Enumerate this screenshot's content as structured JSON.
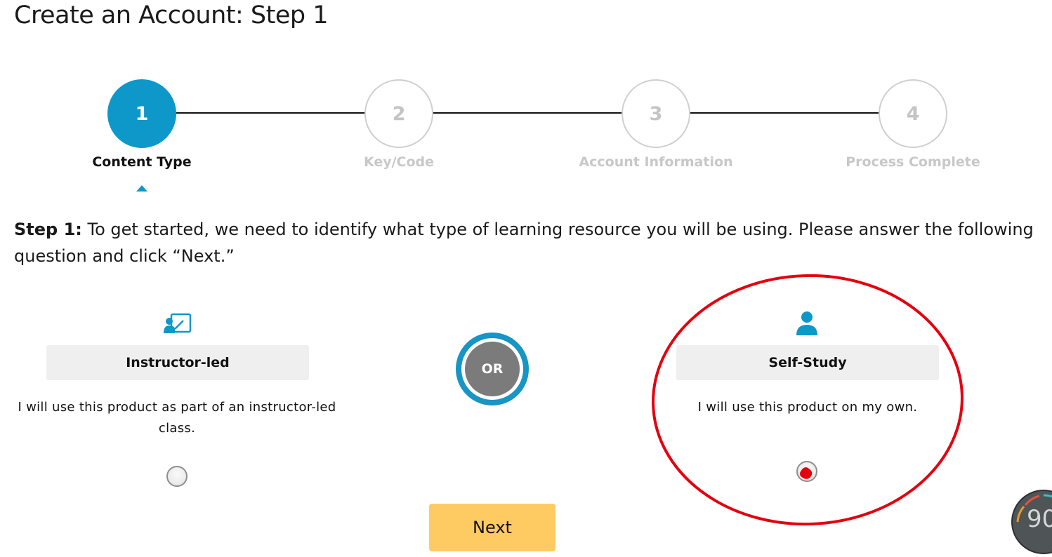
{
  "page_title": "Create an Account: Step 1",
  "stepper": {
    "steps": [
      {
        "number": "1",
        "label": "Content Type",
        "active": true
      },
      {
        "number": "2",
        "label": "Key/Code",
        "active": false
      },
      {
        "number": "3",
        "label": "Account Information",
        "active": false
      },
      {
        "number": "4",
        "label": "Process Complete",
        "active": false
      }
    ]
  },
  "instructions": {
    "lead": "Step 1:",
    "text": " To get started, we need to identify what type of learning resource you will be using. Please answer the following question and click “Next.”"
  },
  "options": {
    "instructor": {
      "icon": "instructor-board-icon",
      "title": "Instructor-led",
      "description": "I will use this product as part of an instructor-led class.",
      "selected": false
    },
    "or_label": "OR",
    "self_study": {
      "icon": "person-icon",
      "title": "Self-Study",
      "description": "I will use this product on my own.",
      "selected": false
    }
  },
  "next_button": {
    "label": "Next"
  },
  "score_badge": {
    "value": "90"
  },
  "colors": {
    "accent": "#0d98c9",
    "button": "#fecb63",
    "annotation": "#e3000f",
    "inactive": "#c8c8c8"
  }
}
